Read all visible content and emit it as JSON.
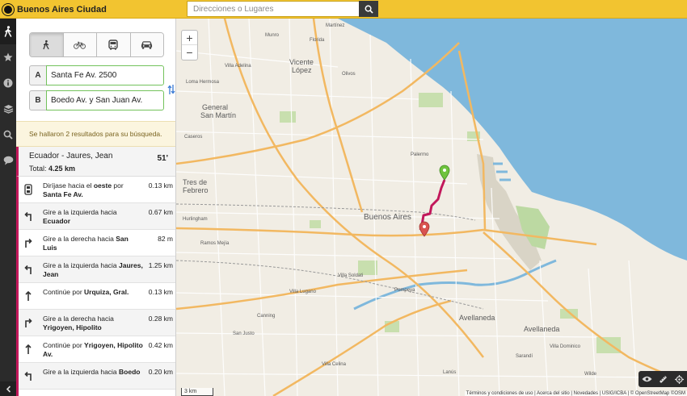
{
  "header": {
    "app_title": "Buenos Aires Ciudad",
    "search": {
      "placeholder": "Direcciones o Lugares",
      "button_icon": "search-icon"
    }
  },
  "left_rail": {
    "items": [
      {
        "icon": "walk-icon",
        "active": true
      },
      {
        "icon": "star-icon"
      },
      {
        "icon": "info-icon"
      },
      {
        "icon": "layers-icon"
      },
      {
        "icon": "search-icon"
      },
      {
        "icon": "chat-icon"
      }
    ],
    "bottom_icon": "chevron-left-icon"
  },
  "directions": {
    "modes": [
      {
        "icon": "walk-icon",
        "active": true
      },
      {
        "icon": "bicycle-icon"
      },
      {
        "icon": "bus-icon"
      },
      {
        "icon": "car-icon"
      }
    ],
    "origin": {
      "label": "A",
      "value": "Santa Fe Av. 2500"
    },
    "destination": {
      "label": "B",
      "value": "Boedo Av. y San Juan Av."
    },
    "notice": "Se hallaron 2 resultados para su búsqueda.",
    "route": {
      "name": "Ecuador - Jaures, Jean",
      "time": "51'",
      "total_label": "Total:",
      "total_value": "4.25 km"
    },
    "steps": [
      {
        "icon": "start-icon",
        "text": "Diríjase hacia el ",
        "bold1": "oeste",
        "mid": " por ",
        "bold2": "Santa Fe Av.",
        "dist": "0.13 km"
      },
      {
        "icon": "turn-left-icon",
        "text": "Gire a la izquierda hacia ",
        "bold1": "",
        "mid": "",
        "bold2": "Ecuador",
        "dist": "0.67 km"
      },
      {
        "icon": "turn-right-icon",
        "text": "Gire a la derecha hacia ",
        "bold1": "",
        "mid": "",
        "bold2": "San Luis",
        "dist": "82 m"
      },
      {
        "icon": "turn-left-icon",
        "text": "Gire a la izquierda hacia ",
        "bold1": "",
        "mid": "",
        "bold2": "Jaures, Jean",
        "dist": "1.25 km"
      },
      {
        "icon": "straight-icon",
        "text": "Continúe por ",
        "bold1": "",
        "mid": "",
        "bold2": "Urquiza, Gral.",
        "dist": "0.13 km"
      },
      {
        "icon": "turn-right-icon",
        "text": "Gire a la derecha hacia ",
        "bold1": "",
        "mid": "",
        "bold2": "Yrigoyen, Hipolito",
        "dist": "0.28 km"
      },
      {
        "icon": "straight-icon",
        "text": "Continúe por ",
        "bold1": "",
        "mid": "",
        "bold2": "Yrigoyen, Hipolito Av.",
        "dist": "0.42 km"
      },
      {
        "icon": "turn-left-icon",
        "text": "Gire a la izquierda hacia ",
        "bold1": "",
        "mid": "",
        "bold2": "Boedo",
        "dist": "0.20 km"
      }
    ]
  },
  "map": {
    "zoom_in": "+",
    "zoom_out": "−",
    "scale": "3 km",
    "attribution": "Términos y condiciones de uso | Acerca del sitio | Novedades | USIG/ICBA | © OpenStreetMap ©OSM",
    "labels": {
      "vicente_lopez": [
        "Vicente",
        "López"
      ],
      "general_san_martin": [
        "General",
        "San Martín"
      ],
      "tres_de_febrero": [
        "Tres de",
        "Febrero"
      ],
      "buenos_aires": "Buenos Aires",
      "avellaneda": "Avellaneda",
      "avellaneda_city": "Avellaneda",
      "villa_lugano": "Villa Lugano",
      "villa_dominico": "Villa Dominico",
      "wilde": "Wilde",
      "sarandi": "Sarandí",
      "canning": "Canning",
      "villa_adelina": "Villa Adelina",
      "florida": "Florida",
      "munro": "Munro",
      "caseros": "Caseros",
      "loma_hermosa": "Loma Hermosa",
      "hurlingham": "Hurlingham",
      "ramos_mejia": "Ramos Mejía",
      "lanus": "Lanús",
      "villa_celina": "Villa Celina",
      "san_justo": "San Justo",
      "martinez": "Martínez",
      "olivos": "Olivos",
      "palermo": "Palermo",
      "pompeya": "Pompeya",
      "villa_soldati": "Villa Soldati"
    },
    "tools": [
      "eye-icon",
      "ruler-icon",
      "locate-icon"
    ],
    "colors": {
      "water": "#7fb8dc",
      "route": "#c2185b",
      "start_marker": "#6fc33d",
      "end_marker": "#d9534f",
      "accent": "#f2c430"
    }
  }
}
